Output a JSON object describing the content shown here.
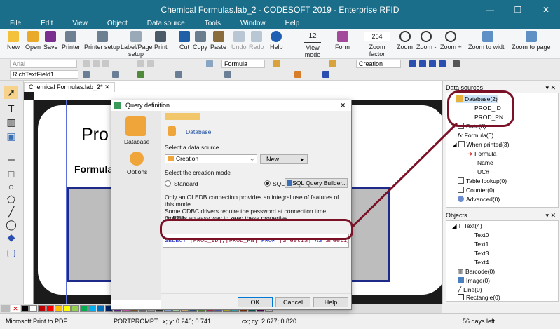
{
  "window": {
    "title": "Chemical Formulas.lab_2 - CODESOFT 2019 - Enterprise RFID",
    "min": "—",
    "max": "❐",
    "close": "✕"
  },
  "menu": [
    "File",
    "Edit",
    "View",
    "Object",
    "Data source",
    "Tools",
    "Window",
    "Help"
  ],
  "ribbon": {
    "new": "New",
    "open": "Open",
    "save": "Save",
    "printer": "Printer",
    "printer_setup": "Printer setup",
    "label_page_setup": "Label/Page setup",
    "print": "Print",
    "cut": "Cut",
    "copy": "Copy",
    "paste": "Paste",
    "undo": "Undo",
    "redo": "Redo",
    "help": "Help",
    "view_mode": "View mode",
    "view_mode_value": "12",
    "form": "Form",
    "zoom_factor": "Zoom factor",
    "zoom_value": "264",
    "zoom": "Zoom",
    "zoom_minus": "Zoom -",
    "zoom_plus": "Zoom +",
    "zoom_to_width": "Zoom to width",
    "zoom_to_page": "Zoom to page"
  },
  "toolbar2": {
    "font": "Arial",
    "formula": "Formula",
    "creation": "Creation"
  },
  "toolbar3": {
    "field": "RichTextField1"
  },
  "doc": {
    "tab": "Chemical Formulas.lab_2*",
    "tab_close": "✕",
    "big_text": "Pro",
    "bold_text": "Formula"
  },
  "datasources": {
    "header": "Data sources",
    "items": [
      {
        "label": "Database(2)",
        "indent": 0
      },
      {
        "label": "PROD_ID",
        "indent": 2
      },
      {
        "label": "PROD_PN",
        "indent": 2
      },
      {
        "label": "Date(0)",
        "indent": 1
      },
      {
        "label": "Formula(0)",
        "indent": 1
      },
      {
        "label": "When printed(3)",
        "indent": 1
      },
      {
        "label": "Formula",
        "indent": 2
      },
      {
        "label": "Name",
        "indent": 2
      },
      {
        "label": "UC#",
        "indent": 2
      },
      {
        "label": "Table lookup(0)",
        "indent": 1
      },
      {
        "label": "Counter(0)",
        "indent": 1
      },
      {
        "label": "Advanced(0)",
        "indent": 1
      }
    ]
  },
  "objects": {
    "header": "Objects",
    "items": [
      {
        "label": "Text(4)",
        "indent": 1
      },
      {
        "label": "Text0",
        "indent": 2
      },
      {
        "label": "Text1",
        "indent": 2
      },
      {
        "label": "Text3",
        "indent": 2
      },
      {
        "label": "Text4",
        "indent": 2
      },
      {
        "label": "Barcode(0)",
        "indent": 1
      },
      {
        "label": "Image(0)",
        "indent": 1
      },
      {
        "label": "Line(0)",
        "indent": 1
      },
      {
        "label": "Rectangle(0)",
        "indent": 1
      }
    ]
  },
  "dialog": {
    "title": "Query definition",
    "side_database": "Database",
    "side_options": "Options",
    "heading": "Database",
    "select_source_label": "Select a data source",
    "source_value": "Creation",
    "new_button": "New...",
    "creation_mode_label": "Select the creation mode",
    "standard": "Standard",
    "sql": "SQL",
    "sql_builder": "SQL Query Builder...",
    "info1": "Only an OLEDB connection provides an integral use of features of this mode.",
    "info2": "Some ODBC drivers require the password at connection time, OLEDB",
    "info3": "provides an easy way to keep these properties.",
    "sql_parts": {
      "select": "SELECT",
      "cols": " [PROD_ID],[PROD_PN] ",
      "from": "FROM",
      "table": " [Sheet1$] ",
      "as": "AS",
      "alias": " Sheet1_"
    },
    "ok": "OK",
    "cancel": "Cancel",
    "help": "Help"
  },
  "status": {
    "printer": "Microsoft Print to PDF",
    "port": "PORTPROMPT:",
    "xy": "x; y: 0.246; 0.741",
    "cxcy": "cx; cy: 2.677; 0.820",
    "days": "56 days left"
  },
  "colors": {
    "titlebar": "#1a6e8a",
    "callout": "#7a1126",
    "accent": "#1526c8"
  }
}
